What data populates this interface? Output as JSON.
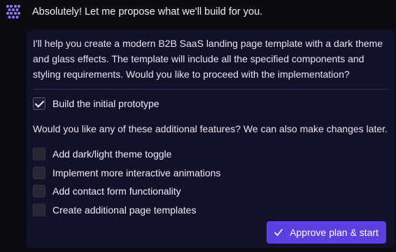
{
  "header": {
    "intro_text": "Absolutely! Let me propose what we'll build for you."
  },
  "plan": {
    "description": "I'll help you create a modern B2B SaaS landing page template with a dark theme and glass effects. The template will include all the specified components and styling requirements. Would you like to proceed with the implementation?",
    "primary_item": {
      "label": "Build the initial prototype",
      "checked": true
    },
    "question": "Would you like any of these additional features? We can also make changes later.",
    "options": [
      {
        "label": "Add dark/light theme toggle",
        "checked": false
      },
      {
        "label": "Implement more interactive animations",
        "checked": false
      },
      {
        "label": "Add contact form functionality",
        "checked": false
      },
      {
        "label": "Create additional page templates",
        "checked": false
      }
    ],
    "approve_label": "Approve plan & start"
  },
  "colors": {
    "accent": "#5b3fe0",
    "card_bg": "#11112a",
    "page_bg": "#0b0b11",
    "logo": "#8a7cf6"
  },
  "icons": {
    "logo": "assistant-logo-icon",
    "check": "check-icon"
  }
}
